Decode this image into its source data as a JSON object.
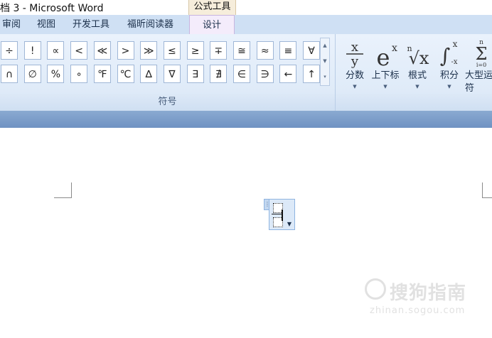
{
  "window": {
    "title": "档 3 - Microsoft Word",
    "context_tab": "公式工具"
  },
  "tabs": [
    {
      "label": "审阅",
      "active": false
    },
    {
      "label": "视图",
      "active": false
    },
    {
      "label": "开发工具",
      "active": false
    },
    {
      "label": "福昕阅读器",
      "active": false
    },
    {
      "label": "设计",
      "active": true
    }
  ],
  "symbols": {
    "row1": [
      "÷",
      "!",
      "∝",
      "<",
      "≪",
      ">",
      "≫",
      "≤",
      "≥",
      "∓",
      "≅",
      "≈",
      "≡",
      "∀"
    ],
    "row2": [
      "∩",
      "∅",
      "%",
      "∘",
      "℉",
      "℃",
      "∆",
      "∇",
      "∃",
      "∄",
      "∈",
      "∋",
      "←",
      "↑"
    ],
    "group_label": "符号"
  },
  "structures": [
    {
      "icon": "fraction-icon",
      "label": "分数"
    },
    {
      "icon": "script-icon",
      "label": "上下标"
    },
    {
      "icon": "radical-icon",
      "label": "根式"
    },
    {
      "icon": "integral-icon",
      "label": "积分"
    },
    {
      "icon": "large-operator-icon",
      "label": "大型运算符"
    }
  ],
  "glyphs": {
    "fraction_num": "x",
    "fraction_den": "y",
    "script_base": "e",
    "script_sup": "x",
    "radical_index": "n",
    "radical_body": "√x",
    "integral_sign": "∫",
    "integral_upper": "x",
    "integral_lower": "-x",
    "sum_sign": "Σ",
    "sum_upper": "n",
    "sum_lower": "i=0"
  },
  "watermark": {
    "text": "搜狗指南",
    "url": "zhinan.sogou.com"
  },
  "colors": {
    "ribbon": "#dbe8f7",
    "tab_bar": "#cfe0f4",
    "context_tab": "#f6eddb",
    "active_tab": "#f4ecfb",
    "band": "#6f92c2"
  }
}
